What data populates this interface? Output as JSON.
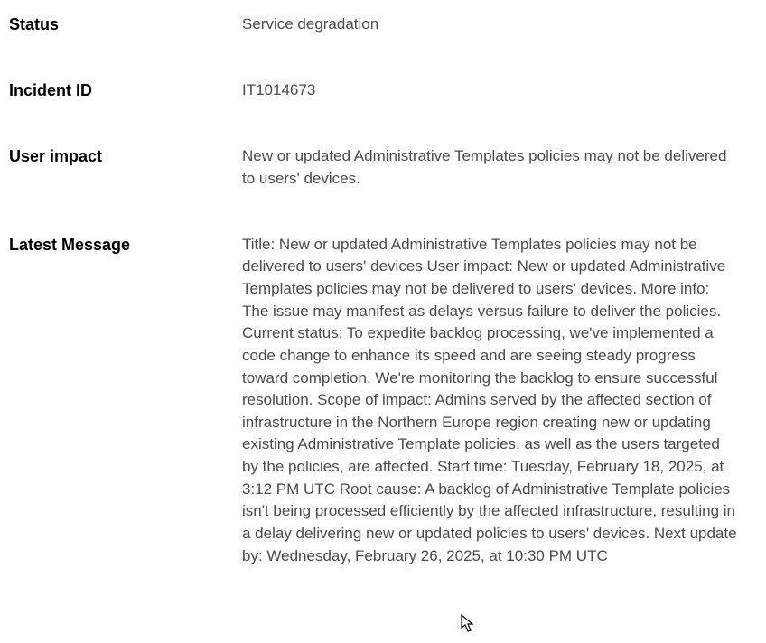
{
  "rows": {
    "status": {
      "label": "Status",
      "value": "Service degradation"
    },
    "incident_id": {
      "label": "Incident ID",
      "value": "IT1014673"
    },
    "user_impact": {
      "label": "User impact",
      "value": "New or updated Administrative Templates policies may not be delivered to users' devices."
    },
    "latest_message": {
      "label": "Latest Message",
      "value": "Title: New or updated Administrative Templates policies may not be delivered to users' devices User impact: New or updated Administrative Templates policies may not be delivered to users' devices. More info: The issue may manifest as delays versus failure to deliver the policies. Current status: To expedite backlog processing, we've implemented a code change to enhance its speed and are seeing steady progress toward completion. We're monitoring the backlog to ensure successful resolution. Scope of impact: Admins served by the affected section of infrastructure in the Northern Europe region creating new or updating existing Administrative Template policies, as well as the users targeted by the policies, are affected. Start time: Tuesday, February 18, 2025, at 3:12 PM UTC Root cause: A backlog of Administrative Template policies isn't being processed efficiently by the affected infrastructure, resulting in a delay delivering new or updated policies to users' devices. Next update by: Wednesday, February 26, 2025, at 10:30 PM UTC"
    }
  }
}
